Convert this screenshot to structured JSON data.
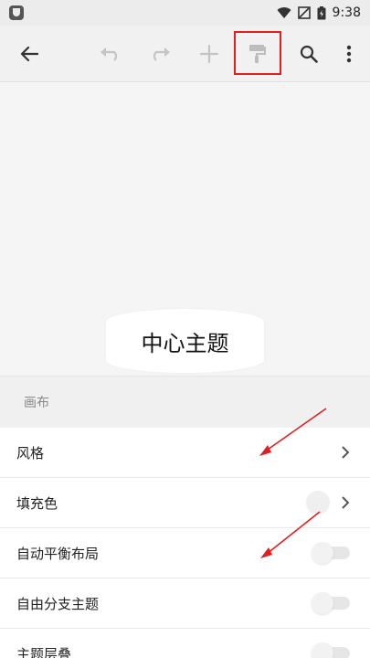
{
  "status_bar": {
    "time": "9:38",
    "icons": [
      "app-badge",
      "wifi-icon",
      "signal-off-icon",
      "battery-icon"
    ]
  },
  "toolbar": {
    "buttons": [
      {
        "name": "back-icon",
        "enabled": true
      },
      {
        "name": "undo-icon",
        "enabled": false
      },
      {
        "name": "redo-icon",
        "enabled": false
      },
      {
        "name": "add-icon",
        "enabled": false
      },
      {
        "name": "paint-roller-icon",
        "enabled": true,
        "highlighted": true
      },
      {
        "name": "search-icon",
        "enabled": true
      },
      {
        "name": "more-vert-icon",
        "enabled": true
      }
    ],
    "highlight_color": "#e02020"
  },
  "canvas": {
    "central_topic": "中心主题"
  },
  "settings": {
    "section_title": "画布",
    "rows": [
      {
        "label": "风格",
        "control": "chevron"
      },
      {
        "label": "填充色",
        "control": "color-chevron"
      },
      {
        "label": "自动平衡布局",
        "control": "toggle",
        "on": false
      },
      {
        "label": "自由分支主题",
        "control": "toggle",
        "on": false
      },
      {
        "label": "主题层叠",
        "control": "toggle",
        "on": false
      }
    ]
  },
  "annotations": {
    "arrow_color": "#e02020"
  }
}
